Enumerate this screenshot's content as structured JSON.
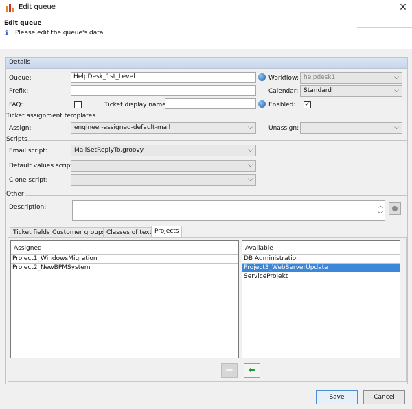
{
  "window": {
    "title": "Edit queue",
    "close_label": "✕"
  },
  "header": {
    "title": "Edit queue",
    "subtitle": "Please edit the queue's data.",
    "info_glyph": "i"
  },
  "details": {
    "group_label": "Details",
    "queue": {
      "label": "Queue:",
      "value": "HelpDesk_1st_Level"
    },
    "workflow": {
      "label": "Workflow:",
      "value": "helpdesk1"
    },
    "prefix": {
      "label": "Prefix:",
      "value": ""
    },
    "calendar": {
      "label": "Calendar:",
      "value": "Standard"
    },
    "faq": {
      "label": "FAQ:",
      "checked": false
    },
    "ticket_display_name": {
      "label": "Ticket display name:",
      "value": ""
    },
    "enabled": {
      "label": "Enabled:",
      "checked": true
    }
  },
  "ticket_assignment": {
    "section_label": "Ticket assignment templates",
    "assign": {
      "label": "Assign:",
      "value": "engineer-assigned-default-mail"
    },
    "unassign": {
      "label": "Unassign:",
      "value": ""
    }
  },
  "scripts": {
    "section_label": "Scripts",
    "email": {
      "label": "Email script:",
      "value": "MailSetReplyTo.groovy"
    },
    "default_values": {
      "label": "Default values script:",
      "value": ""
    },
    "clone": {
      "label": "Clone script:",
      "value": ""
    }
  },
  "other": {
    "section_label": "Other",
    "description": {
      "label": "Description:",
      "value": ""
    }
  },
  "tabs": [
    {
      "label": "Ticket fields"
    },
    {
      "label": "Customer groups"
    },
    {
      "label": "Classes of text"
    },
    {
      "label": "Projects"
    }
  ],
  "projects": {
    "assigned_header": "Assigned",
    "assigned": [
      "Project1_WindowsMigration",
      "Project2_NewBPMSystem"
    ],
    "available_header": "Available",
    "available": [
      "DB Administration",
      "Project3_WebServerUpdate",
      "ServiceProjekt"
    ],
    "selected_available_index": 1
  },
  "colors": {
    "accent": "#3d87d8",
    "arrow_green": "#1e9a3a"
  },
  "buttons": {
    "save": "Save",
    "cancel": "Cancel"
  }
}
